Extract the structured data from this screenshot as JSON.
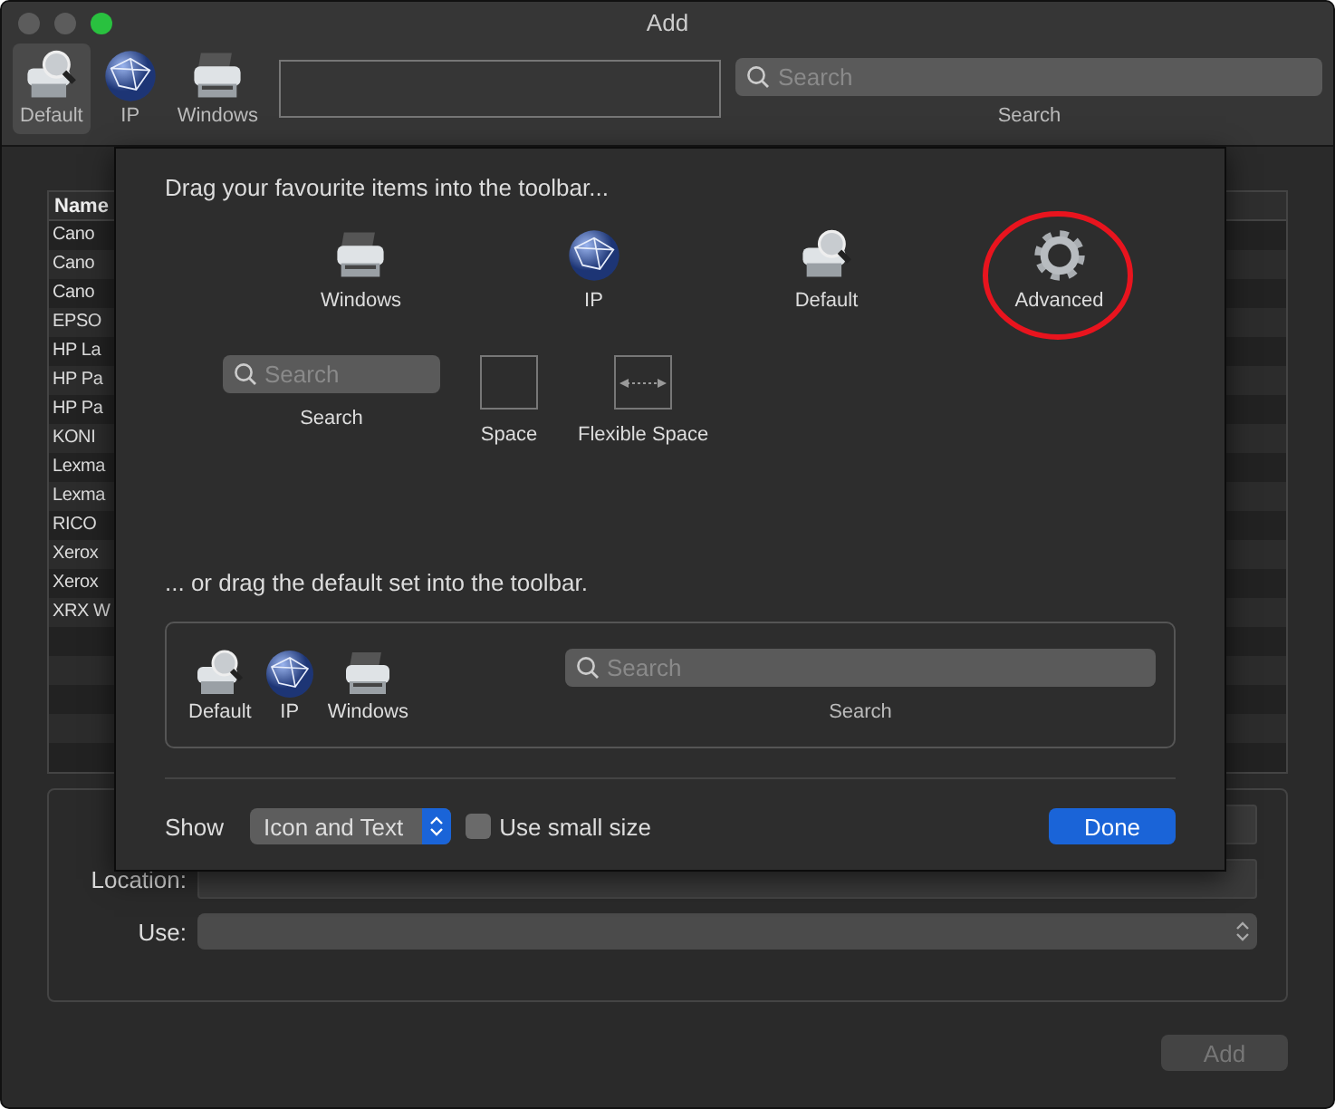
{
  "window": {
    "title": "Add"
  },
  "toolbar": {
    "items": [
      {
        "kind": "default",
        "label": "Default",
        "selected": true
      },
      {
        "kind": "ip",
        "label": "IP",
        "selected": false
      },
      {
        "kind": "windows",
        "label": "Windows",
        "selected": false
      }
    ],
    "search": {
      "placeholder": "Search",
      "label": "Search"
    }
  },
  "printer_list": {
    "columns": [
      "Name"
    ],
    "rows": [
      "Cano",
      "Cano",
      "Cano",
      "EPSO",
      "HP La",
      "HP Pa",
      "HP Pa",
      "KONI",
      "Lexma",
      "Lexma",
      "RICO",
      "Xerox",
      "Xerox",
      "XRX W"
    ]
  },
  "form": {
    "fields": [
      {
        "kind": "text"
      },
      {
        "kind": "text",
        "label": "Location:"
      },
      {
        "kind": "popup",
        "label": "Use:"
      }
    ]
  },
  "add_button": {
    "label": "Add",
    "disabled": true
  },
  "sheet": {
    "heading": "Drag your favourite items into the toolbar...",
    "items": [
      {
        "kind": "windows",
        "label": "Windows",
        "highlighted": false
      },
      {
        "kind": "ip",
        "label": "IP",
        "highlighted": false
      },
      {
        "kind": "default",
        "label": "Default",
        "highlighted": false
      },
      {
        "kind": "gear",
        "label": "Advanced",
        "highlighted": true
      }
    ],
    "layout_items": [
      {
        "kind": "search",
        "label": "Search",
        "placeholder": "Search",
        "highlighted": false
      },
      {
        "kind": "space",
        "label": "Space",
        "highlighted": false
      },
      {
        "kind": "flexible-space",
        "label": "Flexible Space",
        "highlighted": false
      }
    ],
    "default_heading": "... or drag the default set into the toolbar.",
    "default_set": [
      {
        "kind": "default",
        "label": "Default"
      },
      {
        "kind": "ip",
        "label": "IP"
      },
      {
        "kind": "windows",
        "label": "Windows"
      }
    ],
    "default_search": {
      "placeholder": "Search",
      "label": "Search"
    },
    "show_label": "Show",
    "show_value": "Icon and Text",
    "small_size": {
      "label": "Use small size",
      "checked": false
    },
    "done": "Done"
  }
}
